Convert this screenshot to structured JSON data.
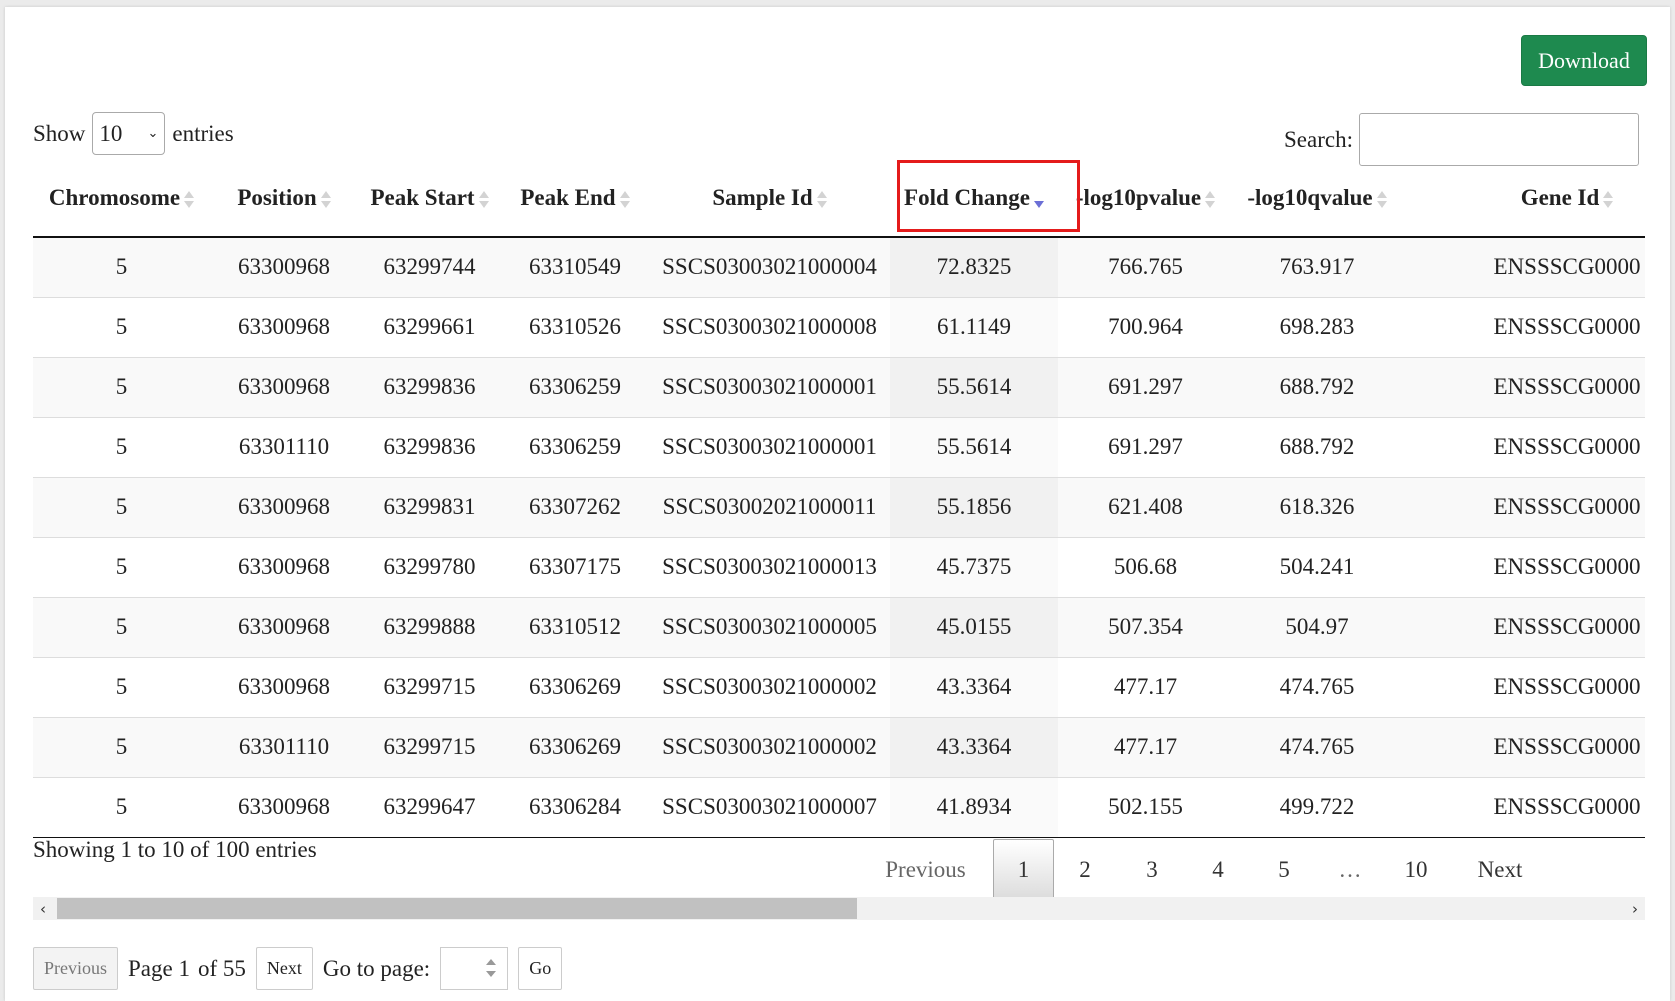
{
  "toolbar": {
    "download_label": "Download"
  },
  "length_menu": {
    "show_label": "Show",
    "selected": "10",
    "entries_label": "entries"
  },
  "search": {
    "label": "Search:",
    "value": ""
  },
  "table": {
    "columns": [
      {
        "label": "Chromosome",
        "sort": "none"
      },
      {
        "label": "Position",
        "sort": "none"
      },
      {
        "label": "Peak Start",
        "sort": "none"
      },
      {
        "label": "Peak End",
        "sort": "none"
      },
      {
        "label": "Sample Id",
        "sort": "none"
      },
      {
        "label": "Fold Change",
        "sort": "desc"
      },
      {
        "label": "-log10pvalue",
        "sort": "none"
      },
      {
        "label": "-log10qvalue",
        "sort": "none"
      },
      {
        "label": "Gene Id",
        "sort": "none"
      }
    ],
    "rows": [
      [
        "5",
        "63300968",
        "63299744",
        "63310549",
        "SSCS03003021000004",
        "72.8325",
        "766.765",
        "763.917",
        "ENSSSCG0000"
      ],
      [
        "5",
        "63300968",
        "63299661",
        "63310526",
        "SSCS03003021000008",
        "61.1149",
        "700.964",
        "698.283",
        "ENSSSCG0000"
      ],
      [
        "5",
        "63300968",
        "63299836",
        "63306259",
        "SSCS03003021000001",
        "55.5614",
        "691.297",
        "688.792",
        "ENSSSCG0000"
      ],
      [
        "5",
        "63301110",
        "63299836",
        "63306259",
        "SSCS03003021000001",
        "55.5614",
        "691.297",
        "688.792",
        "ENSSSCG0000"
      ],
      [
        "5",
        "63300968",
        "63299831",
        "63307262",
        "SSCS03002021000011",
        "55.1856",
        "621.408",
        "618.326",
        "ENSSSCG0000"
      ],
      [
        "5",
        "63300968",
        "63299780",
        "63307175",
        "SSCS03003021000013",
        "45.7375",
        "506.68",
        "504.241",
        "ENSSSCG0000"
      ],
      [
        "5",
        "63300968",
        "63299888",
        "63310512",
        "SSCS03003021000005",
        "45.0155",
        "507.354",
        "504.97",
        "ENSSSCG0000"
      ],
      [
        "5",
        "63300968",
        "63299715",
        "63306269",
        "SSCS03003021000002",
        "43.3364",
        "477.17",
        "474.765",
        "ENSSSCG0000"
      ],
      [
        "5",
        "63301110",
        "63299715",
        "63306269",
        "SSCS03003021000002",
        "43.3364",
        "477.17",
        "474.765",
        "ENSSSCG0000"
      ],
      [
        "5",
        "63300968",
        "63299647",
        "63306284",
        "SSCS03003021000007",
        "41.8934",
        "502.155",
        "499.722",
        "ENSSSCG0000"
      ]
    ]
  },
  "info_text": "Showing 1 to 10 of 100 entries",
  "pagination": {
    "previous": "Previous",
    "pages": [
      "1",
      "2",
      "3",
      "4",
      "5",
      "…",
      "10"
    ],
    "current": "1",
    "next": "Next"
  },
  "bottom_pager": {
    "previous": "Previous",
    "page_label": "Page 1",
    "of_label": "of 55",
    "next": "Next",
    "goto_label": "Go to page:",
    "goto_value": "",
    "go": "Go"
  }
}
